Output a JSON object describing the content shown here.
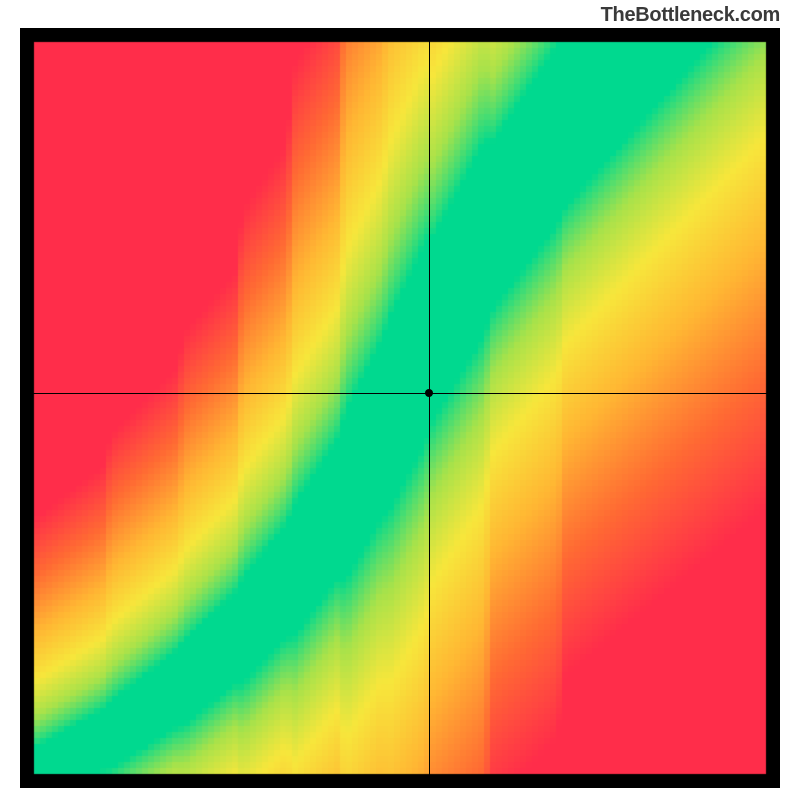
{
  "watermark": "TheBottleneck.com",
  "chart_data": {
    "type": "heatmap",
    "title": "",
    "xlabel": "",
    "ylabel": "",
    "xlim": [
      0,
      100
    ],
    "ylim": [
      0,
      100
    ],
    "crosshair": {
      "x": 54,
      "y": 52
    },
    "marker": {
      "x": 54,
      "y": 52
    },
    "optimal_curve": [
      {
        "x": 0,
        "y": 0
      },
      {
        "x": 10,
        "y": 5
      },
      {
        "x": 20,
        "y": 12
      },
      {
        "x": 28,
        "y": 19
      },
      {
        "x": 35,
        "y": 27
      },
      {
        "x": 42,
        "y": 37
      },
      {
        "x": 48,
        "y": 48
      },
      {
        "x": 54,
        "y": 60
      },
      {
        "x": 62,
        "y": 74
      },
      {
        "x": 72,
        "y": 88
      },
      {
        "x": 82,
        "y": 100
      }
    ],
    "band_half_width_base": 3.2,
    "band_half_width_growth": 0.055,
    "color_stops": [
      {
        "t": 0.0,
        "hex": "#00d98f"
      },
      {
        "t": 0.18,
        "hex": "#a8e24a"
      },
      {
        "t": 0.35,
        "hex": "#f7e63b"
      },
      {
        "t": 0.55,
        "hex": "#ffb733"
      },
      {
        "t": 0.78,
        "hex": "#ff6a33"
      },
      {
        "t": 1.0,
        "hex": "#ff2d4a"
      }
    ],
    "pixel_size": 6,
    "border_px": 14
  }
}
